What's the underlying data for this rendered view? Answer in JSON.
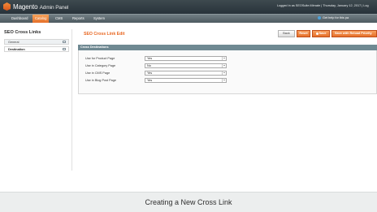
{
  "header": {
    "logo_brand": "Magento",
    "logo_rest": "Admin Panel",
    "info": "Logged in as SEOSuite.Mirnate  |  Thursday, January 12, 2017  |  Log"
  },
  "nav": {
    "items": [
      {
        "label": "Dashboard",
        "active": false
      },
      {
        "label": "Catalog",
        "active": true
      },
      {
        "label": "CMS",
        "active": false
      },
      {
        "label": "Reports",
        "active": false
      },
      {
        "label": "System",
        "active": false
      }
    ],
    "help": "Get help for this pa"
  },
  "sidebar": {
    "title": "SEO Cross Links",
    "tabs": [
      {
        "label": "General",
        "active": false
      },
      {
        "label": "Destination",
        "active": true
      }
    ]
  },
  "main": {
    "title": "SEO Cross Link Edit",
    "buttons": {
      "back": "Back",
      "reset": "Reset",
      "save": "Save",
      "save_reload": "Save with Reload Priority"
    },
    "fieldset": {
      "title": "Cross Destinations",
      "rows": [
        {
          "label": "Use for Product Page",
          "value": "Yes"
        },
        {
          "label": "Use in Category Page",
          "value": "No"
        },
        {
          "label": "Use in CMS Page",
          "value": "Yes"
        },
        {
          "label": "Use in Blog Post Page",
          "value": "Yes"
        }
      ]
    }
  },
  "caption": "Creating a New Cross Link",
  "colors": {
    "accent": "#e5702a",
    "header": "#2f3a40",
    "nav": "#5f6b70",
    "fieldset_head": "#6f8992"
  }
}
